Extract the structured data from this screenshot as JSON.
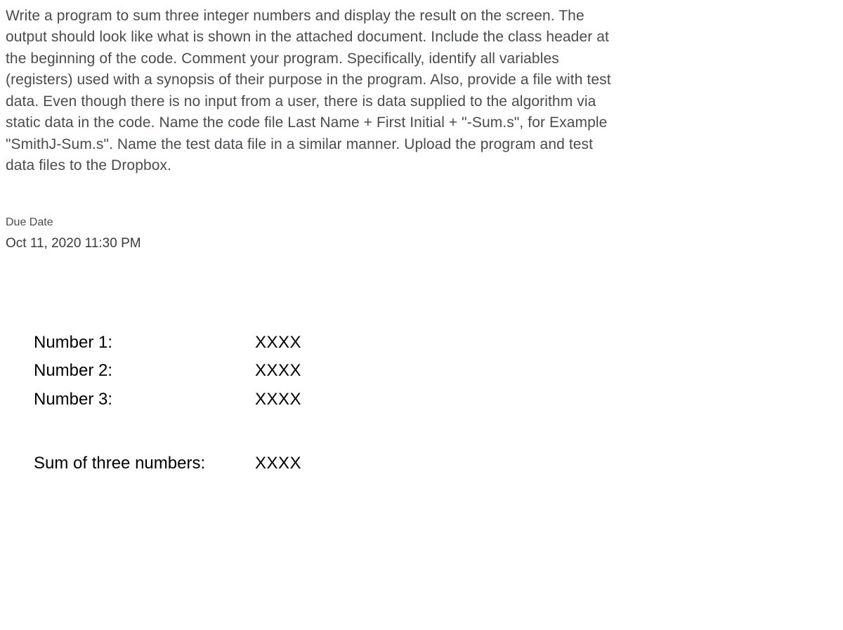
{
  "instructions": "Write a program to sum three integer numbers and display the result on the screen. The output should look like what is shown in the attached document. Include the class header at the beginning of the code. Comment your program.  Specifically, identify all variables (registers) used with a synopsis of their purpose in the program.  Also, provide a file with test data.  Even though there is no input from a user, there is data supplied to the algorithm via static data in the code.  Name the code file Last Name + First Initial + \"-Sum.s\", for Example \"SmithJ-Sum.s\".  Name the test data file in a similar manner.  Upload the program and test data files to the Dropbox.",
  "due_date": {
    "label": "Due Date",
    "value": "Oct 11, 2020 11:30 PM"
  },
  "output": {
    "rows": [
      {
        "label": "Number 1:",
        "value": "XXXX"
      },
      {
        "label": "Number 2:",
        "value": "XXXX"
      },
      {
        "label": "Number 3:",
        "value": "XXXX"
      }
    ],
    "sum": {
      "label": "Sum of three numbers:",
      "value": "XXXX"
    }
  }
}
